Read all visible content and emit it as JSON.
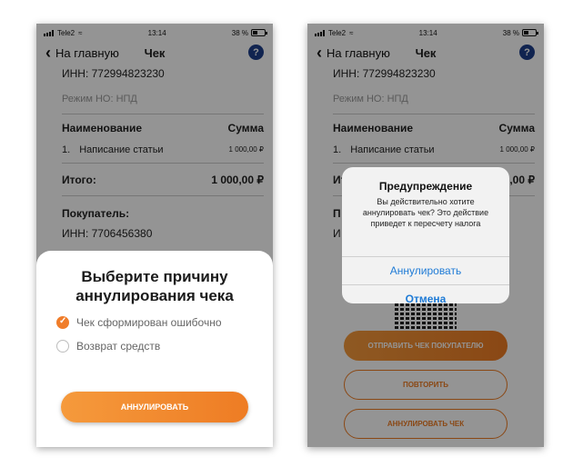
{
  "status": {
    "carrier_left": "Tele2",
    "carrier_right": "Tele2",
    "time": "13:14",
    "battery": "38 %",
    "battery_level": 0.38
  },
  "nav": {
    "back_label": "На главную",
    "title": "Чек",
    "help_label": "?"
  },
  "receipt": {
    "inn": "ИНН: 772994823230",
    "tax_mode": "Режим НО: НПД",
    "col_name": "Наименование",
    "col_sum": "Сумма",
    "item_index": "1.",
    "item_name": "Написание статьи",
    "item_name_right": "Написание статьи",
    "item_sum": "1 000,00 ₽",
    "total_label": "Итого:",
    "total_value": "1 000,00 ₽",
    "buyer_label": "Покупатель:",
    "buyer_inn": "ИНН: 7706456380",
    "buyer_label_cut": "П",
    "buyer_inn_cut": "И"
  },
  "sheet": {
    "title": "Выберите причину аннулирования чека",
    "reasons": [
      {
        "label": "Чек сформирован ошибочно",
        "checked": true
      },
      {
        "label": "Возврат средств",
        "checked": false
      }
    ],
    "button": "АННУЛИРОВАТЬ"
  },
  "alert": {
    "title": "Предупреждение",
    "message": "Вы действительно хотите аннулировать чек? Это действие приведет к пересчету налога",
    "confirm": "Аннулировать",
    "cancel": "Отмена"
  },
  "actions": {
    "send": "ОТПРАВИТЬ ЧЕК ПОКУПАТЕЛЮ",
    "repeat": "ПОВТОРИТЬ",
    "cancel_receipt": "АННУЛИРОВАТЬ ЧЕК"
  },
  "colors": {
    "accent": "#ee7c24",
    "help": "#1e3f8a",
    "link": "#1f7bd6"
  }
}
